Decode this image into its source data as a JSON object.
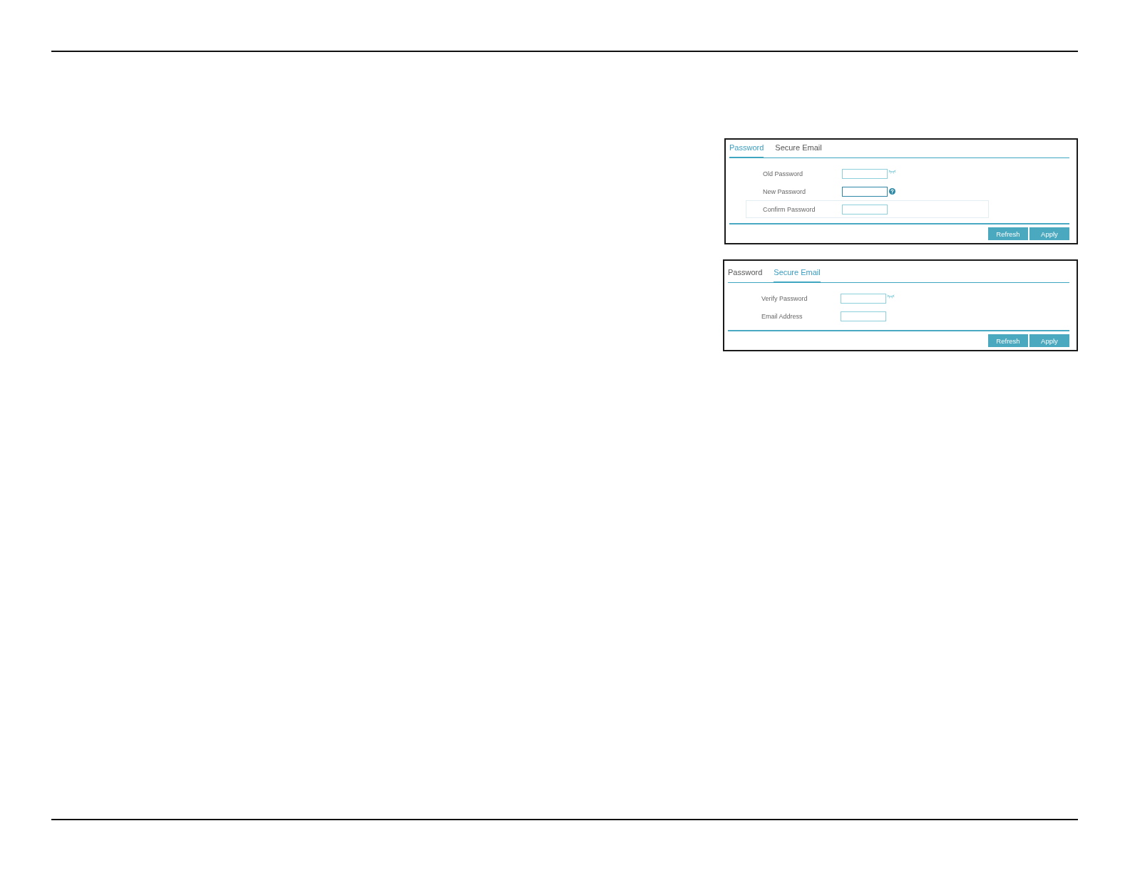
{
  "panels": [
    {
      "tabs": [
        {
          "label": "Password",
          "selected": true
        },
        {
          "label": "Secure Email",
          "selected": false
        }
      ],
      "fields": [
        {
          "label": "Old Password",
          "kind": "reveal",
          "focused": false,
          "highlighted": false
        },
        {
          "label": "New Password",
          "kind": "help",
          "focused": true,
          "highlighted": false
        },
        {
          "label": "Confirm Password",
          "kind": "plain",
          "focused": false,
          "highlighted": true
        }
      ],
      "buttons": [
        {
          "label": "Refresh"
        },
        {
          "label": "Apply"
        }
      ]
    },
    {
      "tabs": [
        {
          "label": "Password",
          "selected": false
        },
        {
          "label": "Secure Email",
          "selected": true
        }
      ],
      "fields": [
        {
          "label": "Verify Password",
          "kind": "reveal",
          "focused": false,
          "highlighted": false
        },
        {
          "label": "Email Address",
          "kind": "plain",
          "focused": false,
          "highlighted": false
        }
      ],
      "buttons": [
        {
          "label": "Refresh"
        },
        {
          "label": "Apply"
        }
      ]
    }
  ]
}
